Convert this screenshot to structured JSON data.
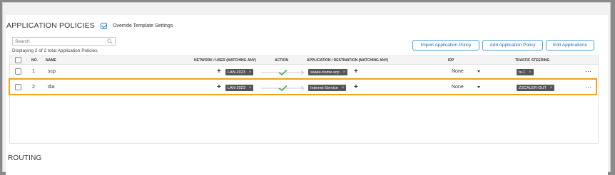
{
  "section": {
    "title": "APPLICATION POLICIES",
    "override_label": "Override Template Settings",
    "override_checked": true
  },
  "search": {
    "placeholder": "Search"
  },
  "summary": "Displaying 2 of 2 total Application Policies",
  "buttons": {
    "import": "Import Application Policy",
    "add": "Add Application Policy",
    "edit": "Edit Applications"
  },
  "table": {
    "headers": {
      "no": "NO.",
      "name": "NAME",
      "network": "NETWORK / USER (MATCHING ANY)",
      "action": "ACTION",
      "application": "APPLICATION / DESTINATION (MATCHING ANY)",
      "idp": "IDP",
      "steering": "TRAFFIC STEERING"
    },
    "rows": [
      {
        "no": "1",
        "name": "scp",
        "network_tag": "LAN-2023",
        "application_tag": "saake-home-scp",
        "idp": "None",
        "steering_tag": "ts-1"
      },
      {
        "no": "2",
        "name": "dia",
        "network_tag": "LAN-2023",
        "application_tag": "Internet-Service",
        "idp": "None",
        "steering_tag": "ZSCALER-OUT"
      }
    ]
  },
  "glyphs": {
    "plus": "+",
    "remove": "×",
    "more": "···"
  },
  "routing_title": "ROUTING",
  "colors": {
    "accent_blue": "#4aa3d9",
    "highlight_orange": "#f0a41c",
    "tag_bg": "#555555",
    "check_green": "#2fb24a"
  }
}
